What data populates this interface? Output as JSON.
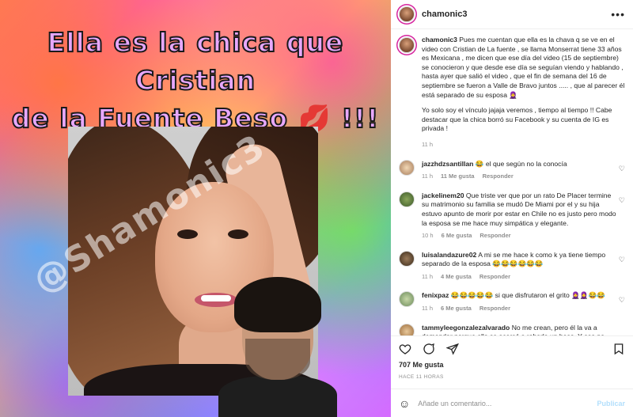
{
  "media": {
    "headline_line1": "Ella es la chica que Cristian",
    "headline_line2": "de la Fuente Beso",
    "headline_emoji": "💋",
    "headline_excl": "!!!",
    "watermark": "@Shamonic3"
  },
  "header": {
    "username": "chamonic3",
    "more_icon": "more-horizontal-icon"
  },
  "caption": {
    "username": "chamonic3",
    "paragraph1": "Pues me cuentan que ella es la chava q se ve en el video con Cristian de La fuente , se llama Monserrat tiene 33 años es Mexicana , me dicen que ese día del video (15 de septiembre) se conocieron y que desde ese día se seguían viendo y hablando , hasta ayer que salió el video , que el fin de semana del 16 de septiembre se fueron a Valle de Bravo juntos ..... , que al parecer él está separado de su esposa 🧕",
    "paragraph2": "Yo solo soy el vínculo jajaja veremos , tiempo al tiempo !! Cabe destacar que la chica borró su Facebook y su cuenta de IG es privada !",
    "time": "11 h"
  },
  "comments": [
    {
      "username": "jazzhdzsantillan",
      "text": "😂 el que según no la conocía",
      "time": "11 h",
      "likes": "11 Me gusta",
      "reply": "Responder"
    },
    {
      "username": "jackelinem20",
      "text": "Que triste ver que por un rato De Placer termine su matrimonio su familia se mudó De Miami por el y su hija estuvo apunto de morir por estar en Chile no es justo pero modo la esposa se me hace muy simpática y elegante.",
      "time": "10 h",
      "likes": "6 Me gusta",
      "reply": "Responder"
    },
    {
      "username": "luisalandazure02",
      "text": "A mi se me hace k como k ya tiene tiempo separado de la esposa 😂😂😂😂😂😂",
      "time": "11 h",
      "likes": "4 Me gusta",
      "reply": "Responder"
    },
    {
      "username": "fenixpaz",
      "text": "😂😂😂😂😂 si que disfrutaron el grito 🧕🧕😂😂",
      "time": "11 h",
      "likes": "6 Me gusta",
      "reply": "Responder"
    },
    {
      "username": "tammyleegonzalezalvarado",
      "text": "No me crean, pero él la va a demandar porque ella se acercó a robarle un beso. Y eso no",
      "time": "",
      "likes": "",
      "reply": ""
    }
  ],
  "stats": {
    "likes": "707 Me gusta",
    "ago": "HACE 11 HORAS"
  },
  "composer": {
    "placeholder": "Añade un comentario...",
    "publish_label": "Publicar"
  },
  "colors": {
    "publish_disabled": "#b2dffc",
    "meta_gray": "#8e8e8e",
    "story_ring": "#d6249f"
  }
}
